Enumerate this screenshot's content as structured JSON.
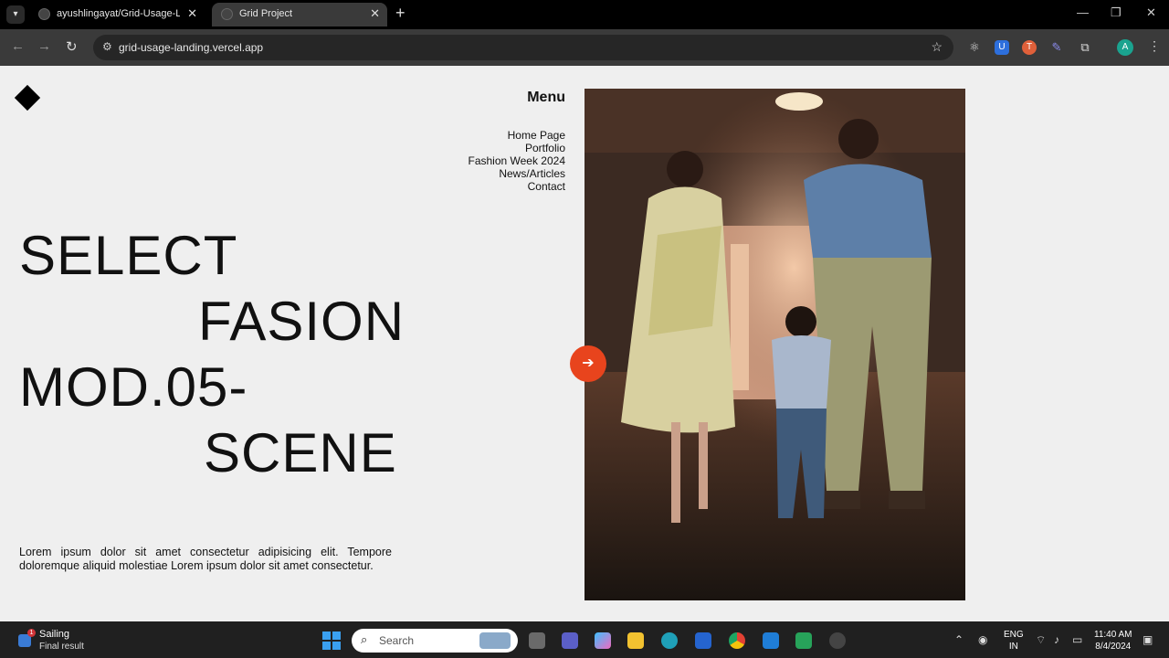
{
  "browser": {
    "tabs": [
      {
        "title": "ayushlingayat/Grid-Usage-Landi",
        "active": false
      },
      {
        "title": "Grid Project",
        "active": true
      }
    ],
    "url": "grid-usage-landing.vercel.app",
    "profile_initial": "A"
  },
  "page": {
    "menu_title": "Menu",
    "menu_items": [
      "Home Page",
      "Portfolio",
      "Fashion Week 2024",
      "News/Articles",
      "Contact"
    ],
    "headline": [
      "SELECT",
      "FASION",
      "MOD.05-",
      "SCENE"
    ],
    "body_text": "Lorem ipsum dolor sit amet consectetur adipisicing elit. Tempore doloremque aliquid molestiae Lorem ipsum dolor sit amet consectetur.",
    "arrow_icon": "arrow-right-icon",
    "accent_color": "#e8441d"
  },
  "taskbar": {
    "weather_title": "Sailing",
    "weather_subtitle": "Final result",
    "weather_badge": "1",
    "search_placeholder": "Search",
    "lang_line1": "ENG",
    "lang_line2": "IN",
    "time": "11:40 AM",
    "date": "8/4/2024"
  }
}
